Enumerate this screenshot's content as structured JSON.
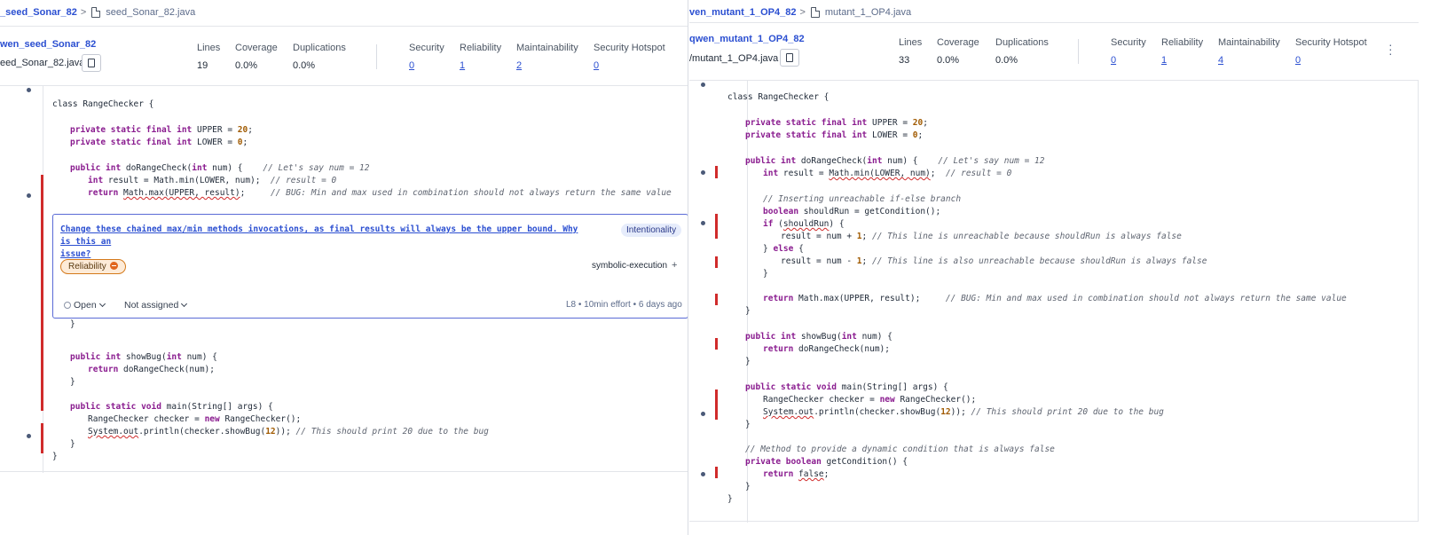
{
  "left": {
    "breadcrumb": {
      "project": "_seed_Sonar_82",
      "separator": ">",
      "file": "seed_Sonar_82.java"
    },
    "header": {
      "project_name": "wen_seed_Sonar_82",
      "file_path": "eed_Sonar_82.java"
    },
    "metrics": {
      "lines_label": "Lines",
      "lines_value": "19",
      "coverage_label": "Coverage",
      "coverage_value": "0.0%",
      "duplications_label": "Duplications",
      "duplications_value": "0.0%",
      "security_label": "Security",
      "security_value": "0",
      "reliability_label": "Reliability",
      "reliability_value": "1",
      "maintainability_label": "Maintainability",
      "maintainability_value": "2",
      "hotspot_label": "Security Hotspot",
      "hotspot_value": "0"
    },
    "issue": {
      "message_line1": "Change these chained max/min methods invocations, as final results will always be the upper bound. Why is this an",
      "message_line2": "issue?",
      "attribute": "Intentionality",
      "quality": "Reliability",
      "tag": "symbolic-execution",
      "add_tag": "+",
      "status": "Open",
      "assignee": "Not assigned",
      "effort": "L8 • 10min effort • 6 days ago"
    }
  },
  "right": {
    "breadcrumb": {
      "project": "ven_mutant_1_OP4_82",
      "separator": ">",
      "file": "mutant_1_OP4.java"
    },
    "header": {
      "project_name": "qwen_mutant_1_OP4_82",
      "file_path": "/mutant_1_OP4.java"
    },
    "metrics": {
      "lines_label": "Lines",
      "lines_value": "33",
      "coverage_label": "Coverage",
      "coverage_value": "0.0%",
      "duplications_label": "Duplications",
      "duplications_value": "0.0%",
      "security_label": "Security",
      "security_value": "0",
      "reliability_label": "Reliability",
      "reliability_value": "1",
      "maintainability_label": "Maintainability",
      "maintainability_value": "4",
      "hotspot_label": "Security Hotspot",
      "hotspot_value": "0"
    },
    "more_icon": "kebab-menu-icon"
  },
  "icons": {
    "file": "file-icon",
    "copy": "copy-icon",
    "gutter_dot": "issue-dot-icon",
    "severity": "severity-medium-icon"
  },
  "colors": {
    "accent": "#2b4fd1",
    "issue_marker": "#d02b2b",
    "keyword": "#8a1c8f",
    "number": "#a05a00",
    "issue_border": "#5a6bd6"
  },
  "code_left": [
    [
      {
        "t": "class RangeChecker {"
      }
    ],
    [
      {
        "t": "private static final int ",
        "c": "kw"
      },
      {
        "t": "UPPER = "
      },
      {
        "t": "20",
        "c": "num"
      },
      {
        "t": ";"
      }
    ],
    [
      {
        "t": "private static final int ",
        "c": "kw"
      },
      {
        "t": "LOWER = "
      },
      {
        "t": "0",
        "c": "num"
      },
      {
        "t": ";"
      }
    ],
    [
      {
        "t": "public int ",
        "c": "kw"
      },
      {
        "t": "doRangeCheck("
      },
      {
        "t": "int",
        "c": "kw"
      },
      {
        "t": " num) {    "
      },
      {
        "t": "// Let's say num = 12",
        "c": "cmt"
      }
    ],
    [
      {
        "t": "int",
        "c": "kw"
      },
      {
        "t": " result = Math.min(LOWER, num);  "
      },
      {
        "t": "// result = 0",
        "c": "cmt"
      }
    ],
    [
      {
        "t": "return ",
        "c": "kw"
      },
      {
        "t": "Math.max(UPPER, result)",
        "c": "squig"
      },
      {
        "t": ";     "
      },
      {
        "t": "// BUG: Min and max used in combination should not always return the same value",
        "c": "cmt"
      }
    ],
    [
      {
        "t": "}"
      }
    ],
    [
      {
        "t": "public int ",
        "c": "kw"
      },
      {
        "t": "showBug("
      },
      {
        "t": "int",
        "c": "kw"
      },
      {
        "t": " num) {"
      }
    ],
    [
      {
        "t": "return ",
        "c": "kw"
      },
      {
        "t": "doRangeCheck(num);"
      }
    ],
    [
      {
        "t": "}"
      }
    ],
    [
      {
        "t": "public static void ",
        "c": "kw"
      },
      {
        "t": "main(String[] args) {"
      }
    ],
    [
      {
        "t": "RangeChecker checker = "
      },
      {
        "t": "new ",
        "c": "kw"
      },
      {
        "t": "RangeChecker();"
      }
    ],
    [
      {
        "t": "System.out",
        "c": "squig"
      },
      {
        "t": ".println(checker.showBug("
      },
      {
        "t": "12",
        "c": "num"
      },
      {
        "t": ")); "
      },
      {
        "t": "// This should print 20 due to the bug",
        "c": "cmt"
      }
    ],
    [
      {
        "t": "}"
      }
    ],
    [
      {
        "t": "}"
      }
    ]
  ],
  "code_right": [
    [
      {
        "t": "class RangeChecker {"
      }
    ],
    [
      {
        "t": "private static final int ",
        "c": "kw"
      },
      {
        "t": "UPPER = "
      },
      {
        "t": "20",
        "c": "num"
      },
      {
        "t": ";"
      }
    ],
    [
      {
        "t": "private static final int ",
        "c": "kw"
      },
      {
        "t": "LOWER = "
      },
      {
        "t": "0",
        "c": "num"
      },
      {
        "t": ";"
      }
    ],
    [
      {
        "t": "public int ",
        "c": "kw"
      },
      {
        "t": "doRangeCheck("
      },
      {
        "t": "int",
        "c": "kw"
      },
      {
        "t": " num) {    "
      },
      {
        "t": "// Let's say num = 12",
        "c": "cmt"
      }
    ],
    [
      {
        "t": "int",
        "c": "kw"
      },
      {
        "t": " result = "
      },
      {
        "t": "Math.min(LOWER, num)",
        "c": "squig"
      },
      {
        "t": ";  "
      },
      {
        "t": "// result = 0",
        "c": "cmt"
      }
    ],
    [
      {
        "t": "// Inserting unreachable if-else branch",
        "c": "cmt"
      }
    ],
    [
      {
        "t": "boolean",
        "c": "kw"
      },
      {
        "t": " shouldRun = getCondition();"
      }
    ],
    [
      {
        "t": "if",
        "c": "kw"
      },
      {
        "t": " ("
      },
      {
        "t": "shouldRun",
        "c": "squig"
      },
      {
        "t": ") {"
      }
    ],
    [
      {
        "t": "result = num + "
      },
      {
        "t": "1",
        "c": "num"
      },
      {
        "t": "; "
      },
      {
        "t": "// This line is unreachable because shouldRun is always false",
        "c": "cmt"
      }
    ],
    [
      {
        "t": "} "
      },
      {
        "t": "else",
        "c": "kw"
      },
      {
        "t": " {"
      }
    ],
    [
      {
        "t": "result = num - "
      },
      {
        "t": "1",
        "c": "num"
      },
      {
        "t": "; "
      },
      {
        "t": "// This line is also unreachable because shouldRun is always false",
        "c": "cmt"
      }
    ],
    [
      {
        "t": "}"
      }
    ],
    [
      {
        "t": "return ",
        "c": "kw"
      },
      {
        "t": "Math.max(UPPER, result);     "
      },
      {
        "t": "// BUG: Min and max used in combination should not always return the same value",
        "c": "cmt"
      }
    ],
    [
      {
        "t": "}"
      }
    ],
    [
      {
        "t": "public int ",
        "c": "kw"
      },
      {
        "t": "showBug("
      },
      {
        "t": "int",
        "c": "kw"
      },
      {
        "t": " num) {"
      }
    ],
    [
      {
        "t": "return ",
        "c": "kw"
      },
      {
        "t": "doRangeCheck(num);"
      }
    ],
    [
      {
        "t": "}"
      }
    ],
    [
      {
        "t": "public static void ",
        "c": "kw"
      },
      {
        "t": "main(String[] args) {"
      }
    ],
    [
      {
        "t": "RangeChecker checker = "
      },
      {
        "t": "new ",
        "c": "kw"
      },
      {
        "t": "RangeChecker();"
      }
    ],
    [
      {
        "t": "System.out",
        "c": "squig"
      },
      {
        "t": ".println(checker.showBug("
      },
      {
        "t": "12",
        "c": "num"
      },
      {
        "t": ")); "
      },
      {
        "t": "// This should print 20 due to the bug",
        "c": "cmt"
      }
    ],
    [
      {
        "t": "}"
      }
    ],
    [
      {
        "t": "// Method to provide a dynamic condition that is always false",
        "c": "cmt"
      }
    ],
    [
      {
        "t": "private boolean ",
        "c": "kw"
      },
      {
        "t": "getCondition() {"
      }
    ],
    [
      {
        "t": "return ",
        "c": "kw"
      },
      {
        "t": "false",
        "c": "squig"
      },
      {
        "t": ";"
      }
    ],
    [
      {
        "t": "}"
      }
    ],
    [
      {
        "t": "}"
      }
    ]
  ]
}
